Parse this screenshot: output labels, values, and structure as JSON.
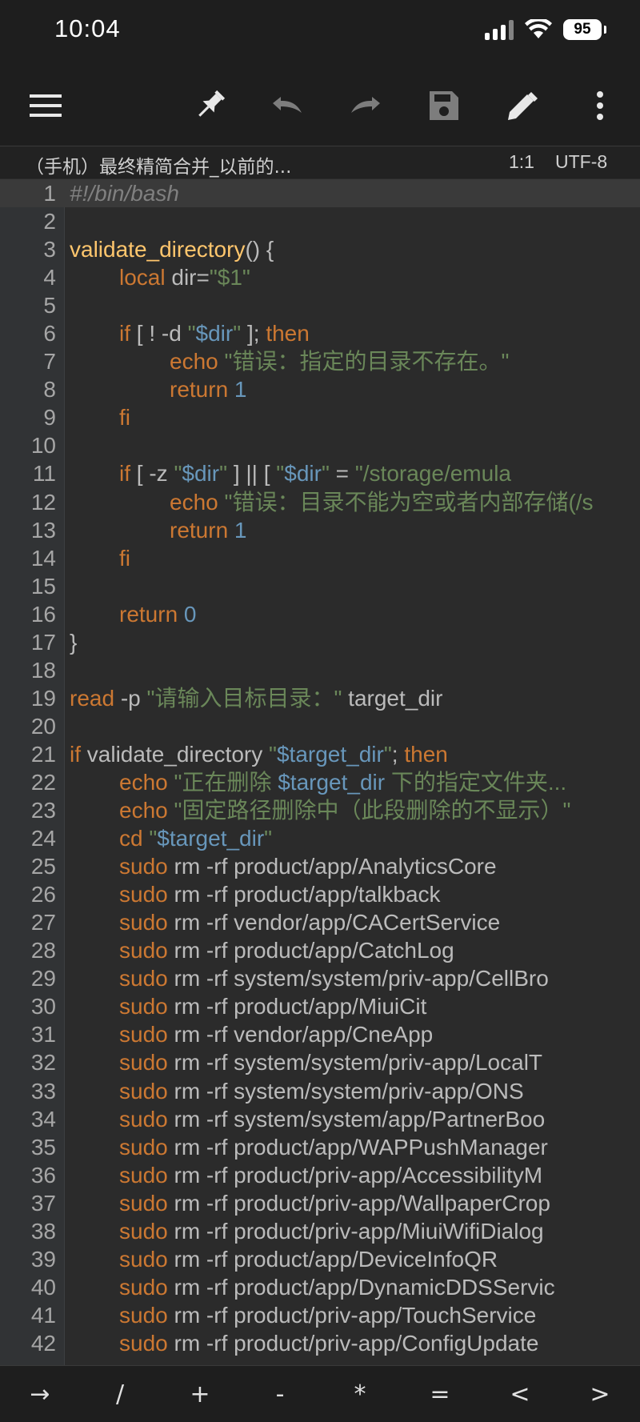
{
  "status_bar": {
    "time": "10:04",
    "battery": "95"
  },
  "toolbar": {
    "buttons": [
      {
        "name": "menu",
        "icon": "hamburger-menu-icon"
      },
      {
        "name": "pin",
        "icon": "pin-icon"
      },
      {
        "name": "undo",
        "icon": "undo-icon"
      },
      {
        "name": "redo",
        "icon": "redo-icon"
      },
      {
        "name": "save",
        "icon": "save-icon"
      },
      {
        "name": "edit",
        "icon": "pencil-icon"
      },
      {
        "name": "more",
        "icon": "more-vertical-icon"
      }
    ]
  },
  "file_bar": {
    "file_name": "（手机）最终精简合并_以前的...",
    "position": "1:1",
    "encoding": "UTF-8"
  },
  "editor": {
    "lines": [
      {
        "n": "1",
        "current": true,
        "tokens": [
          {
            "t": "#!/bin/bash",
            "c": "comment"
          }
        ]
      },
      {
        "n": "2",
        "tokens": []
      },
      {
        "n": "3",
        "tokens": [
          {
            "t": "validate_directory",
            "c": "func"
          },
          {
            "t": "() {",
            "c": "plain"
          }
        ]
      },
      {
        "n": "4",
        "indent": 1,
        "tokens": [
          {
            "t": "local",
            "c": "kw"
          },
          {
            "t": " dir=",
            "c": "plain"
          },
          {
            "t": "\"$1\"",
            "c": "str"
          }
        ]
      },
      {
        "n": "5",
        "tokens": []
      },
      {
        "n": "6",
        "indent": 1,
        "tokens": [
          {
            "t": "if",
            "c": "kw"
          },
          {
            "t": " [ ! -d ",
            "c": "plain"
          },
          {
            "t": "\"",
            "c": "str"
          },
          {
            "t": "$dir",
            "c": "strv"
          },
          {
            "t": "\"",
            "c": "str"
          },
          {
            "t": " ]; ",
            "c": "plain"
          },
          {
            "t": "then",
            "c": "kw"
          }
        ]
      },
      {
        "n": "7",
        "indent": 2,
        "tokens": [
          {
            "t": "echo",
            "c": "kw"
          },
          {
            "t": " \"错误：指定的目录不存在。\"",
            "c": "str"
          }
        ]
      },
      {
        "n": "8",
        "indent": 2,
        "tokens": [
          {
            "t": "return",
            "c": "kw"
          },
          {
            "t": " 1",
            "c": "num"
          }
        ]
      },
      {
        "n": "9",
        "indent": 1,
        "tokens": [
          {
            "t": "fi",
            "c": "kw"
          }
        ]
      },
      {
        "n": "10",
        "tokens": []
      },
      {
        "n": "11",
        "indent": 1,
        "tokens": [
          {
            "t": "if",
            "c": "kw"
          },
          {
            "t": " [ -z ",
            "c": "plain"
          },
          {
            "t": "\"",
            "c": "str"
          },
          {
            "t": "$dir",
            "c": "strv"
          },
          {
            "t": "\"",
            "c": "str"
          },
          {
            "t": " ] || [ ",
            "c": "plain"
          },
          {
            "t": "\"",
            "c": "str"
          },
          {
            "t": "$dir",
            "c": "strv"
          },
          {
            "t": "\"",
            "c": "str"
          },
          {
            "t": " = ",
            "c": "plain"
          },
          {
            "t": "\"/storage/emula",
            "c": "str"
          }
        ]
      },
      {
        "n": "12",
        "indent": 2,
        "tokens": [
          {
            "t": "echo",
            "c": "kw"
          },
          {
            "t": " \"错误：目录不能为空或者内部存储(/s",
            "c": "str"
          }
        ]
      },
      {
        "n": "13",
        "indent": 2,
        "tokens": [
          {
            "t": "return",
            "c": "kw"
          },
          {
            "t": " 1",
            "c": "num"
          }
        ]
      },
      {
        "n": "14",
        "indent": 1,
        "tokens": [
          {
            "t": "fi",
            "c": "kw"
          }
        ]
      },
      {
        "n": "15",
        "tokens": []
      },
      {
        "n": "16",
        "indent": 1,
        "tokens": [
          {
            "t": "return",
            "c": "kw"
          },
          {
            "t": " 0",
            "c": "num"
          }
        ]
      },
      {
        "n": "17",
        "tokens": [
          {
            "t": "}",
            "c": "plain"
          }
        ]
      },
      {
        "n": "18",
        "tokens": []
      },
      {
        "n": "19",
        "tokens": [
          {
            "t": "read",
            "c": "kw"
          },
          {
            "t": " -p ",
            "c": "plain"
          },
          {
            "t": "\"请输入目标目录：\"",
            "c": "str"
          },
          {
            "t": " target_dir",
            "c": "plain"
          }
        ]
      },
      {
        "n": "20",
        "tokens": []
      },
      {
        "n": "21",
        "tokens": [
          {
            "t": "if",
            "c": "kw"
          },
          {
            "t": " validate_directory ",
            "c": "plain"
          },
          {
            "t": "\"",
            "c": "str"
          },
          {
            "t": "$target_dir",
            "c": "strv"
          },
          {
            "t": "\"",
            "c": "str"
          },
          {
            "t": "; ",
            "c": "plain"
          },
          {
            "t": "then",
            "c": "kw"
          }
        ]
      },
      {
        "n": "22",
        "indent": 1,
        "tokens": [
          {
            "t": "echo",
            "c": "kw"
          },
          {
            "t": " \"正在删除 ",
            "c": "str"
          },
          {
            "t": "$target_dir",
            "c": "strv"
          },
          {
            "t": " 下的指定文件夹...",
            "c": "str"
          }
        ]
      },
      {
        "n": "23",
        "indent": 1,
        "tokens": [
          {
            "t": "echo",
            "c": "kw"
          },
          {
            "t": " \"固定路径删除中（此段删除的不显示）\"",
            "c": "str"
          }
        ]
      },
      {
        "n": "24",
        "indent": 1,
        "tokens": [
          {
            "t": "cd",
            "c": "kw"
          },
          {
            "t": " \"",
            "c": "str"
          },
          {
            "t": "$target_dir",
            "c": "strv"
          },
          {
            "t": "\"",
            "c": "str"
          }
        ]
      },
      {
        "n": "25",
        "indent": 1,
        "tokens": [
          {
            "t": "sudo",
            "c": "cmd"
          },
          {
            "t": " rm -rf product/app/AnalyticsCore",
            "c": "plain"
          }
        ]
      },
      {
        "n": "26",
        "indent": 1,
        "tokens": [
          {
            "t": "sudo",
            "c": "cmd"
          },
          {
            "t": " rm -rf product/app/talkback",
            "c": "plain"
          }
        ]
      },
      {
        "n": "27",
        "indent": 1,
        "tokens": [
          {
            "t": "sudo",
            "c": "cmd"
          },
          {
            "t": " rm -rf vendor/app/CACertService",
            "c": "plain"
          }
        ]
      },
      {
        "n": "28",
        "indent": 1,
        "tokens": [
          {
            "t": "sudo",
            "c": "cmd"
          },
          {
            "t": " rm -rf product/app/CatchLog",
            "c": "plain"
          }
        ]
      },
      {
        "n": "29",
        "indent": 1,
        "tokens": [
          {
            "t": "sudo",
            "c": "cmd"
          },
          {
            "t": " rm -rf system/system/priv-app/CellBro",
            "c": "plain"
          }
        ]
      },
      {
        "n": "30",
        "indent": 1,
        "tokens": [
          {
            "t": "sudo",
            "c": "cmd"
          },
          {
            "t": " rm -rf product/app/MiuiCit",
            "c": "plain"
          }
        ]
      },
      {
        "n": "31",
        "indent": 1,
        "tokens": [
          {
            "t": "sudo",
            "c": "cmd"
          },
          {
            "t": " rm -rf vendor/app/CneApp",
            "c": "plain"
          }
        ]
      },
      {
        "n": "32",
        "indent": 1,
        "tokens": [
          {
            "t": "sudo",
            "c": "cmd"
          },
          {
            "t": " rm -rf system/system/priv-app/LocalT",
            "c": "plain"
          }
        ]
      },
      {
        "n": "33",
        "indent": 1,
        "tokens": [
          {
            "t": "sudo",
            "c": "cmd"
          },
          {
            "t": " rm -rf system/system/priv-app/ONS",
            "c": "plain"
          }
        ]
      },
      {
        "n": "34",
        "indent": 1,
        "tokens": [
          {
            "t": "sudo",
            "c": "cmd"
          },
          {
            "t": " rm -rf system/system/app/PartnerBoo",
            "c": "plain"
          }
        ]
      },
      {
        "n": "35",
        "indent": 1,
        "tokens": [
          {
            "t": "sudo",
            "c": "cmd"
          },
          {
            "t": " rm -rf product/app/WAPPushManager",
            "c": "plain"
          }
        ]
      },
      {
        "n": "36",
        "indent": 1,
        "tokens": [
          {
            "t": "sudo",
            "c": "cmd"
          },
          {
            "t": " rm -rf product/priv-app/AccessibilityM",
            "c": "plain"
          }
        ]
      },
      {
        "n": "37",
        "indent": 1,
        "tokens": [
          {
            "t": "sudo",
            "c": "cmd"
          },
          {
            "t": " rm -rf product/priv-app/WallpaperCrop",
            "c": "plain"
          }
        ]
      },
      {
        "n": "38",
        "indent": 1,
        "tokens": [
          {
            "t": "sudo",
            "c": "cmd"
          },
          {
            "t": " rm -rf product/priv-app/MiuiWifiDialog",
            "c": "plain"
          }
        ]
      },
      {
        "n": "39",
        "indent": 1,
        "tokens": [
          {
            "t": "sudo",
            "c": "cmd"
          },
          {
            "t": " rm -rf product/app/DeviceInfoQR",
            "c": "plain"
          }
        ]
      },
      {
        "n": "40",
        "indent": 1,
        "tokens": [
          {
            "t": "sudo",
            "c": "cmd"
          },
          {
            "t": " rm -rf product/app/DynamicDDSServic",
            "c": "plain"
          }
        ]
      },
      {
        "n": "41",
        "indent": 1,
        "tokens": [
          {
            "t": "sudo",
            "c": "cmd"
          },
          {
            "t": " rm -rf product/priv-app/TouchService",
            "c": "plain"
          }
        ]
      },
      {
        "n": "42",
        "indent": 1,
        "tokens": [
          {
            "t": "sudo",
            "c": "cmd"
          },
          {
            "t": " rm -rf product/priv-app/ConfigUpdate",
            "c": "plain"
          }
        ]
      }
    ]
  },
  "keybar": {
    "keys": [
      "→",
      "/",
      "+",
      "-",
      "*",
      "=",
      "<",
      ">"
    ]
  },
  "colors": {
    "background": "#2b2b2b",
    "gutter": "#313335",
    "bars": "#1e1e1e",
    "keyword": "#cc7832",
    "string": "#6a8759",
    "function": "#ffc66d",
    "number": "#6897bb",
    "comment": "#808080"
  }
}
